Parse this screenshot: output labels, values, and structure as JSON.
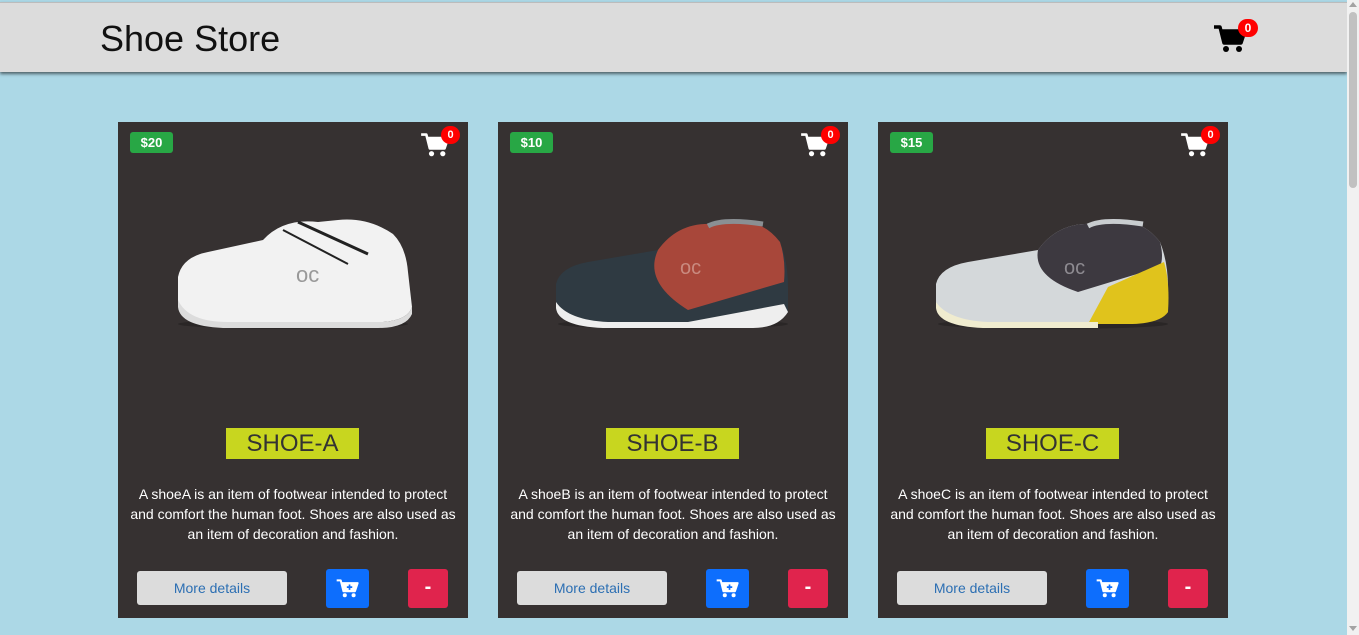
{
  "header": {
    "title": "Shoe Store",
    "cart_count": "0",
    "cart_icon": "cart-icon"
  },
  "colors": {
    "page_bg": "#acd8e6",
    "header_bg": "#dcdcdc",
    "card_bg": "#363131",
    "price_badge": "#28a745",
    "name_badge": "#c8d61f",
    "add_button": "#0d6efd",
    "remove_button": "#e0244d",
    "count_badge": "#ff0000"
  },
  "products": [
    {
      "price": "$20",
      "cart_count": "0",
      "name": "SHOE-A",
      "description": "A shoeA is an item of footwear intended to protect and comfort the human foot. Shoes are also used as an item of decoration and fashion.",
      "details_label": "More details",
      "add_icon": "cart-plus-icon",
      "remove_label": "-"
    },
    {
      "price": "$10",
      "cart_count": "0",
      "name": "SHOE-B",
      "description": "A shoeB is an item of footwear intended to protect and comfort the human foot. Shoes are also used as an item of decoration and fashion.",
      "details_label": "More details",
      "add_icon": "cart-plus-icon",
      "remove_label": "-"
    },
    {
      "price": "$15",
      "cart_count": "0",
      "name": "SHOE-C",
      "description": "A shoeC is an item of footwear intended to protect and comfort the human foot. Shoes are also used as an item of decoration and fashion.",
      "details_label": "More details",
      "add_icon": "cart-plus-icon",
      "remove_label": "-"
    }
  ]
}
